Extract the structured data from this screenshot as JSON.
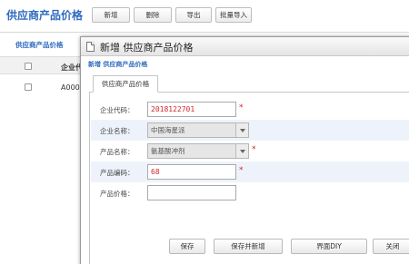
{
  "page": {
    "title": "供应商产品价格",
    "toolbar": {
      "add": "新增",
      "delete": "删除",
      "export": "导出",
      "batch_import": "批量导入"
    },
    "section_title": "供应商产品价格",
    "grid": {
      "column_company": "企业代",
      "row1_code": "A000"
    }
  },
  "dialog": {
    "title": "新增 供应商产品价格",
    "subtitle": "新增 供应商产品价格",
    "tab": "供应商产品价格",
    "fields": {
      "company_code": {
        "label": "企业代码：",
        "value": "2018122701"
      },
      "company_name": {
        "label": "企业名称：",
        "value": "中国海星派"
      },
      "product_name": {
        "label": "产品名称：",
        "value": "氨基酸冲剂"
      },
      "product_code": {
        "label": "产品编码：",
        "value": "68"
      },
      "product_price": {
        "label": "产品价格：",
        "value": ""
      }
    },
    "required_mark": "*",
    "buttons": {
      "save": "保存",
      "save_and_new": "保存并新增",
      "ui_diy": "界面DIY",
      "close": "关闭"
    }
  },
  "colors": {
    "accent": "#2f6bbf",
    "required": "#d0262b",
    "row_alt": "#eef3fb"
  }
}
